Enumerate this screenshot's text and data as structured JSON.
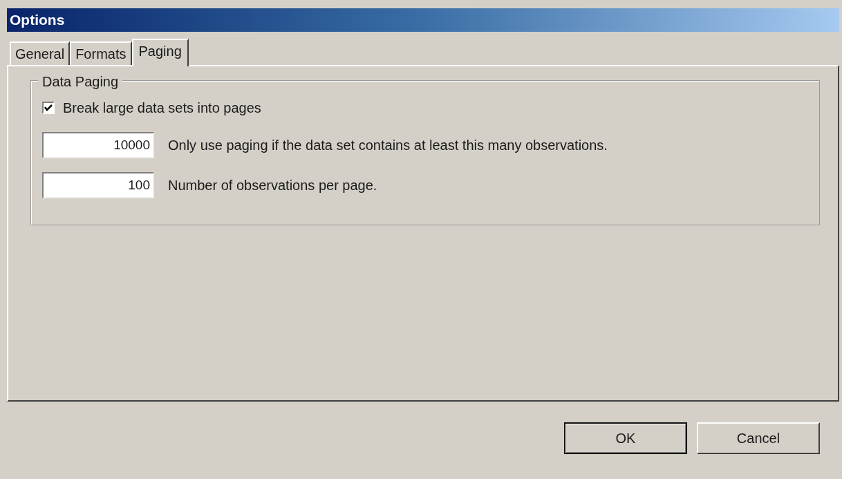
{
  "window": {
    "title": "Options"
  },
  "tabs": [
    {
      "label": "General",
      "selected": false
    },
    {
      "label": "Formats",
      "selected": false
    },
    {
      "label": "Paging",
      "selected": true
    }
  ],
  "group": {
    "title": "Data Paging",
    "checkbox": {
      "label": "Break large data sets into pages",
      "checked": true
    },
    "fields": [
      {
        "value": "10000",
        "label": "Only use paging if the data set contains at least this many observations."
      },
      {
        "value": "100",
        "label": "Number of observations per page."
      }
    ]
  },
  "buttons": [
    {
      "label": "OK",
      "default": true
    },
    {
      "label": "Cancel",
      "default": false
    }
  ]
}
